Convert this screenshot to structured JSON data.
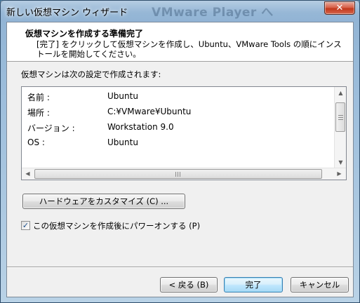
{
  "window": {
    "title": "新しい仮想マシン ウィザード",
    "background_ghost_text": "VMware Player へ",
    "close_glyph": "✕"
  },
  "header": {
    "title": "仮想マシンを作成する準備完了",
    "description": "[完了] をクリックして仮想マシンを作成し、Ubuntu、VMware Tools の順にインストールを開始してください。"
  },
  "settings": {
    "label": "仮想マシンは次の設定で作成されます:",
    "rows": [
      {
        "key": "名前 :",
        "value": "Ubuntu"
      },
      {
        "key": "場所 :",
        "value": "C:¥VMware¥Ubuntu"
      },
      {
        "key": "バージョン :",
        "value": "Workstation 9.0"
      },
      {
        "key": "OS :",
        "value": "Ubuntu"
      }
    ],
    "scroll_up_glyph": "▲",
    "scroll_down_glyph": "▼",
    "scroll_left_glyph": "◀",
    "scroll_right_glyph": "▶"
  },
  "customize_button": "ハードウェアをカスタマイズ (C) ...",
  "power_on": {
    "checked": true,
    "check_glyph": "✓",
    "label": "この仮想マシンを作成後にパワーオンする (P)"
  },
  "footer": {
    "back": "< 戻る (B)",
    "finish": "完了",
    "cancel": "キャンセル"
  },
  "colors": {
    "title_bar": "#8fb2d3",
    "close_button": "#c2381c",
    "default_button_border": "#3c7fb1"
  }
}
